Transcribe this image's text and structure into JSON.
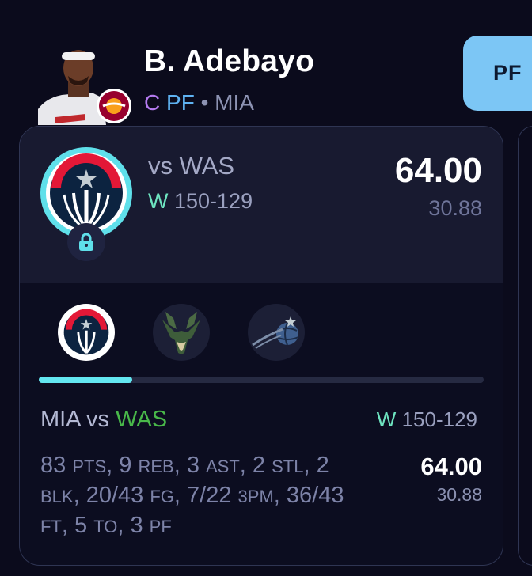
{
  "player": {
    "name": "B. Adebayo",
    "position_primary": "C",
    "position_secondary": "PF",
    "separator": "•",
    "team": "MIA"
  },
  "position_filter": {
    "label": "PF"
  },
  "summary": {
    "matchup": "vs WAS",
    "result_letter": "W",
    "result_score": "150-129",
    "points": "64.00",
    "points_secondary": "30.88",
    "locked_icon": "lock-icon"
  },
  "game_tabs": [
    {
      "team": "WAS",
      "icon": "wizards-logo-icon",
      "selected": true
    },
    {
      "team": "MIL",
      "icon": "bucks-logo-icon",
      "selected": false
    },
    {
      "team": "ORL",
      "icon": "magic-logo-icon",
      "selected": false
    }
  ],
  "tab_progress": 0.21,
  "game_detail": {
    "home_team": "MIA",
    "vs": "vs",
    "opponent": "WAS",
    "result_letter": "W",
    "result_score": "150-129",
    "stats": [
      {
        "value": "83",
        "label": "PTS",
        "sep": ", "
      },
      {
        "value": "9",
        "label": "REB",
        "sep": ", "
      },
      {
        "value": "3",
        "label": "AST",
        "sep": ", "
      },
      {
        "value": "2",
        "label": "STL",
        "sep": ", "
      },
      {
        "value": "2",
        "label": "BLK",
        "sep": ", "
      },
      {
        "value": "20/43",
        "label": "FG",
        "sep": ", "
      },
      {
        "value": "7/22",
        "label": "3PM",
        "sep": ", "
      },
      {
        "value": "36/43",
        "label": "FT",
        "sep": ", "
      },
      {
        "value": "5",
        "label": "TO",
        "sep": ", "
      },
      {
        "value": "3",
        "label": "PF",
        "sep": ""
      }
    ],
    "points": "64.00",
    "points_secondary": "30.88"
  },
  "colors": {
    "background": "#0b0b1c",
    "accent_cyan": "#63e6f0",
    "win_green": "#6ee4c0",
    "opponent_green": "#49b84a",
    "pos_c_purple": "#b57bf0",
    "pos_pf_blue": "#5fb3f3"
  }
}
